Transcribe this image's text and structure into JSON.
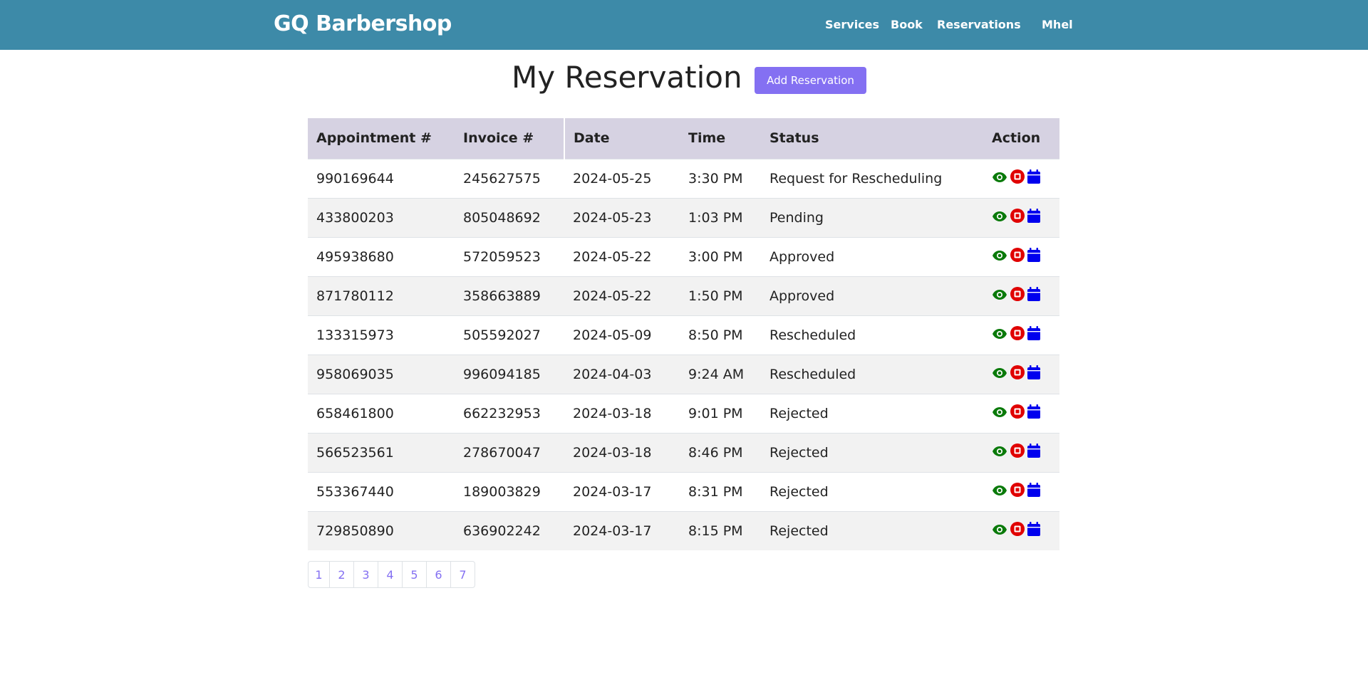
{
  "nav": {
    "brand": "GQ Barbershop",
    "links": [
      "Services",
      "Book",
      "Reservations",
      "Mhel"
    ]
  },
  "page": {
    "title": "My Reservation",
    "add_button": "Add Reservation"
  },
  "table": {
    "headers": [
      "Appointment #",
      "Invoice #",
      "Date",
      "Time",
      "Status",
      "Action"
    ],
    "rows": [
      [
        "990169644",
        "245627575",
        "2024-05-25",
        "3:30 PM",
        "Request for Rescheduling"
      ],
      [
        "433800203",
        "805048692",
        "2024-05-23",
        "1:03 PM",
        "Pending"
      ],
      [
        "495938680",
        "572059523",
        "2024-05-22",
        "3:00 PM",
        "Approved"
      ],
      [
        "871780112",
        "358663889",
        "2024-05-22",
        "1:50 PM",
        "Approved"
      ],
      [
        "133315973",
        "505592027",
        "2024-05-09",
        "8:50 PM",
        "Rescheduled"
      ],
      [
        "958069035",
        "996094185",
        "2024-04-03",
        "9:24 AM",
        "Rescheduled"
      ],
      [
        "658461800",
        "662232953",
        "2024-03-18",
        "9:01 PM",
        "Rejected"
      ],
      [
        "566523561",
        "278670047",
        "2024-03-18",
        "8:46 PM",
        "Rejected"
      ],
      [
        "553367440",
        "189003829",
        "2024-03-17",
        "8:31 PM",
        "Rejected"
      ],
      [
        "729850890",
        "636902242",
        "2024-03-17",
        "8:15 PM",
        "Rejected"
      ]
    ],
    "action_icons": [
      "eye-icon",
      "stop-icon",
      "calendar-icon"
    ]
  },
  "pagination": [
    "1",
    "2",
    "3",
    "4",
    "5",
    "6",
    "7"
  ],
  "colors": {
    "navbar": "#3d8aa8",
    "accent": "#8470f2",
    "header_row": "#d6d2e2",
    "view_icon": "#0a7a0a",
    "cancel_icon": "#e00000",
    "reschedule_icon": "#0000ee"
  }
}
